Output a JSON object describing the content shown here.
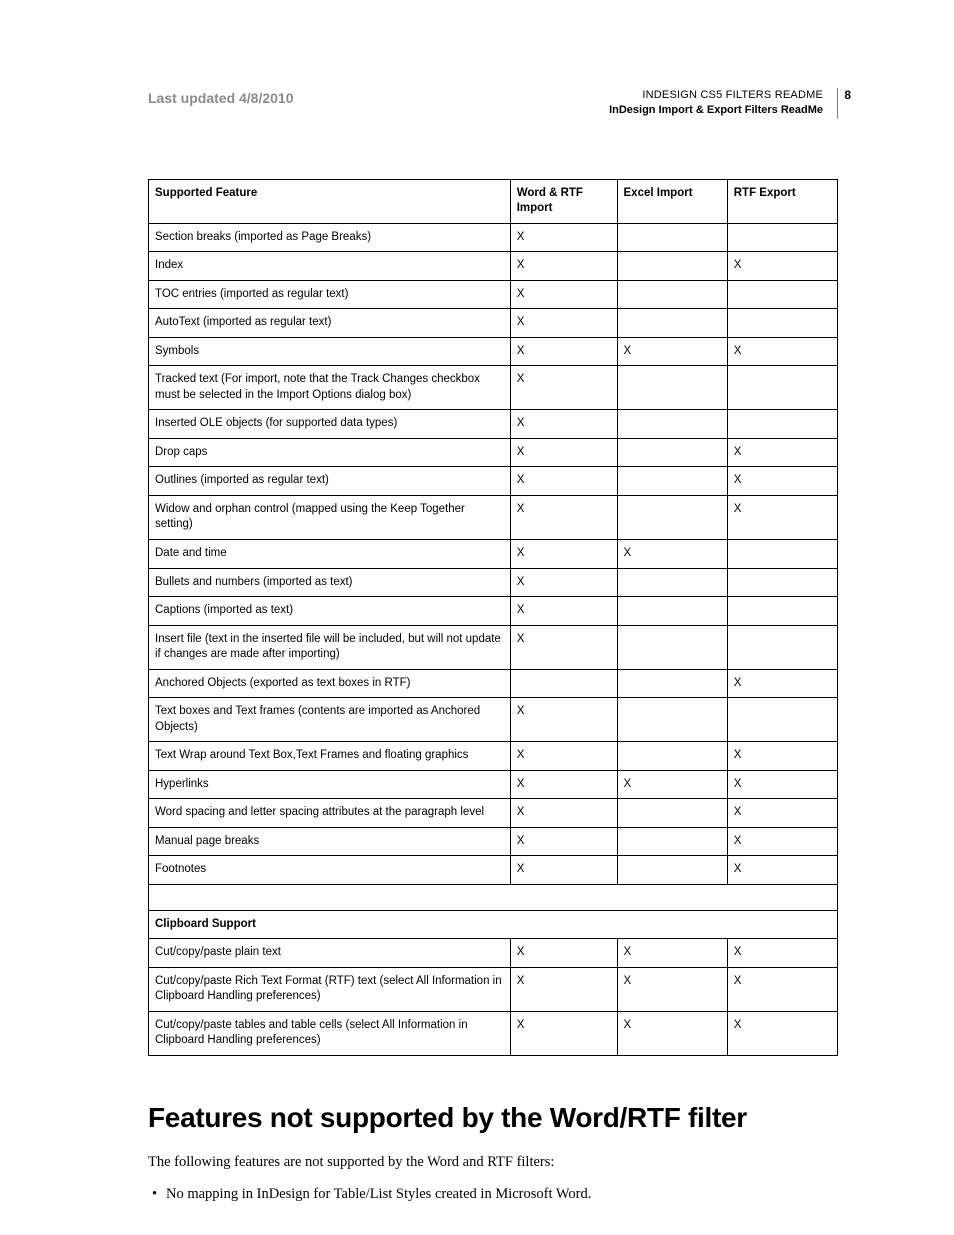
{
  "header": {
    "last_updated": "Last updated 4/8/2010",
    "doc_title_line1": "INDESIGN CS5 FILTERS README",
    "doc_title_line2": "InDesign Import & Export Filters ReadMe",
    "page_number": "8"
  },
  "table": {
    "headers": [
      "Supported Feature",
      "Word & RTF Import",
      "Excel Import",
      "RTF Export"
    ],
    "rows": [
      {
        "feature": "Section breaks (imported as Page Breaks)",
        "word_rtf": "X",
        "excel": "",
        "rtf_export": ""
      },
      {
        "feature": "Index",
        "word_rtf": "X",
        "excel": "",
        "rtf_export": "X"
      },
      {
        "feature": "TOC entries (imported as regular text)",
        "word_rtf": "X",
        "excel": "",
        "rtf_export": ""
      },
      {
        "feature": "AutoText (imported as regular text)",
        "word_rtf": "X",
        "excel": "",
        "rtf_export": ""
      },
      {
        "feature": "Symbols",
        "word_rtf": "X",
        "excel": "X",
        "rtf_export": "X"
      },
      {
        "feature": "Tracked text (For import, note that the Track Changes checkbox must be selected in the Import Options dialog box)",
        "word_rtf": "X",
        "excel": "",
        "rtf_export": ""
      },
      {
        "feature": "Inserted OLE objects (for supported data types)",
        "word_rtf": "X",
        "excel": "",
        "rtf_export": ""
      },
      {
        "feature": "Drop caps",
        "word_rtf": "X",
        "excel": "",
        "rtf_export": "X"
      },
      {
        "feature": "Outlines (imported as regular text)",
        "word_rtf": "X",
        "excel": "",
        "rtf_export": "X"
      },
      {
        "feature": "Widow and orphan control (mapped using the Keep Together setting)",
        "word_rtf": "X",
        "excel": "",
        "rtf_export": "X"
      },
      {
        "feature": "Date and time",
        "word_rtf": "X",
        "excel": "X",
        "rtf_export": ""
      },
      {
        "feature": "Bullets and numbers (imported as text)",
        "word_rtf": "X",
        "excel": "",
        "rtf_export": ""
      },
      {
        "feature": "Captions (imported as text)",
        "word_rtf": "X",
        "excel": "",
        "rtf_export": ""
      },
      {
        "feature": "Insert file (text in the inserted file will be included, but will not update if changes are made after importing)",
        "word_rtf": "X",
        "excel": "",
        "rtf_export": ""
      },
      {
        "feature": "Anchored Objects (exported as text boxes in RTF)",
        "word_rtf": "",
        "excel": "",
        "rtf_export": "X"
      },
      {
        "feature": "Text boxes and Text frames (contents are imported as Anchored Objects)",
        "word_rtf": "X",
        "excel": "",
        "rtf_export": ""
      },
      {
        "feature": "Text Wrap around Text Box,Text Frames and floating graphics",
        "word_rtf": "X",
        "excel": "",
        "rtf_export": "X"
      },
      {
        "feature": "Hyperlinks",
        "word_rtf": "X",
        "excel": "X",
        "rtf_export": "X"
      },
      {
        "feature": "Word spacing and letter spacing attributes at the paragraph level",
        "word_rtf": "X",
        "excel": "",
        "rtf_export": "X"
      },
      {
        "feature": "Manual page breaks",
        "word_rtf": "X",
        "excel": "",
        "rtf_export": "X"
      },
      {
        "feature": "Footnotes",
        "word_rtf": "X",
        "excel": "",
        "rtf_export": "X"
      }
    ],
    "section2_header": "Clipboard Support",
    "section2_rows": [
      {
        "feature": "Cut/copy/paste plain text",
        "word_rtf": "X",
        "excel": "X",
        "rtf_export": "X"
      },
      {
        "feature": "Cut/copy/paste Rich Text Format (RTF) text (select All Information in Clipboard Handling preferences)",
        "word_rtf": "X",
        "excel": "X",
        "rtf_export": "X"
      },
      {
        "feature": "Cut/copy/paste tables and table cells (select All Information in Clipboard Handling preferences)",
        "word_rtf": "X",
        "excel": "X",
        "rtf_export": "X"
      }
    ]
  },
  "section": {
    "title": "Features not supported by the Word/RTF filter",
    "intro": "The following features are not supported by the Word and RTF filters:",
    "bullets": [
      "No mapping in InDesign for Table/List Styles created in Microsoft Word."
    ]
  }
}
